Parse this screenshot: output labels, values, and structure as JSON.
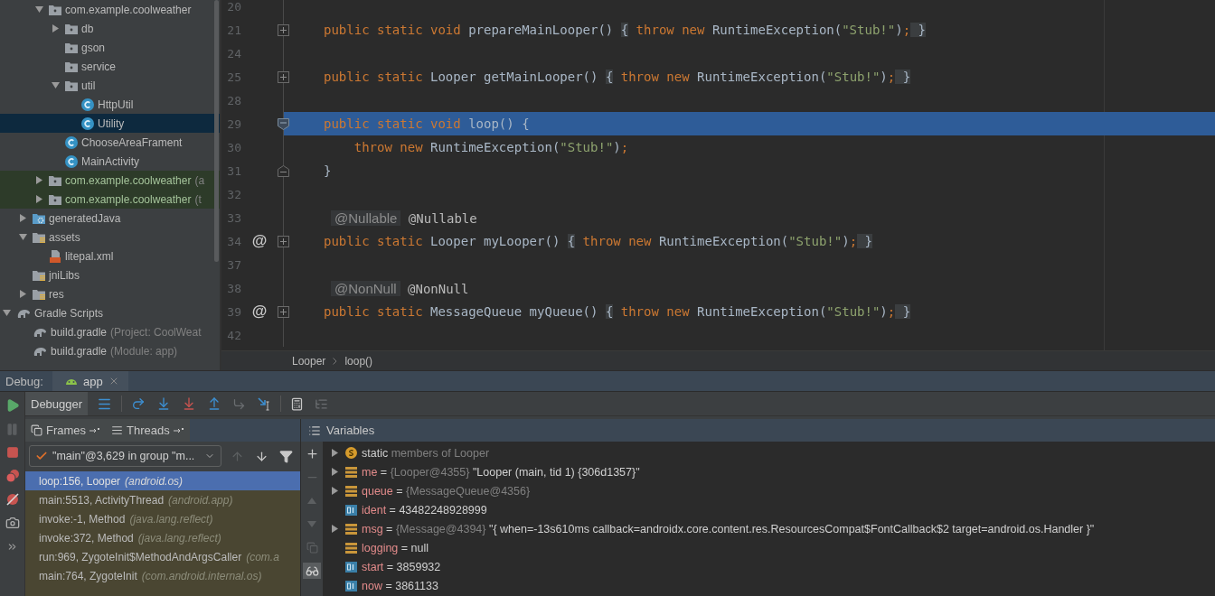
{
  "project_tree": [
    {
      "children": [
        {
          "children": [
            {
              "label": "com.example.coolweather",
              "kind": "package",
              "expanded": true,
              "selected": false,
              "children": [
                {
                  "label": "db",
                  "kind": "package",
                  "expanded": false,
                  "selected": false
                },
                {
                  "label": "gson",
                  "kind": "package",
                  "selected": false
                },
                {
                  "label": "service",
                  "kind": "package",
                  "selected": false
                },
                {
                  "label": "util",
                  "kind": "package",
                  "expanded": true,
                  "selected": false,
                  "children": [
                    {
                      "label": "HttpUtil",
                      "kind": "class",
                      "selected": false
                    },
                    {
                      "label": "Utility",
                      "kind": "class",
                      "selected": true
                    }
                  ]
                },
                {
                  "label": "ChooseAreaFrament",
                  "kind": "class",
                  "selected": false
                },
                {
                  "label": "MainActivity",
                  "kind": "class",
                  "selected": false
                }
              ]
            },
            {
              "label": "com.example.coolweather",
              "suffix": "(a",
              "kind": "test_package",
              "expanded": false,
              "selected": false
            },
            {
              "label": "com.example.coolweather",
              "suffix": "(t",
              "kind": "test_package",
              "expanded": false,
              "selected": false
            }
          ]
        },
        {
          "label": "generatedJava",
          "kind": "generated",
          "expanded": false,
          "selected": false
        },
        {
          "label": "assets",
          "kind": "resources",
          "expanded": true,
          "selected": false,
          "children": [
            {
              "label": "litepal.xml",
              "kind": "xml",
              "selected": false
            }
          ]
        },
        {
          "label": "jniLibs",
          "kind": "resources",
          "selected": false
        },
        {
          "label": "res",
          "kind": "resources",
          "expanded": false,
          "selected": false
        }
      ]
    },
    {
      "label": "Gradle Scripts",
      "kind": "gradle",
      "expanded": true,
      "selected": false,
      "children": [
        {
          "label": "build.gradle",
          "suffix": "(Project: CoolWeat",
          "kind": "gradle",
          "selected": false
        },
        {
          "label": "build.gradle",
          "suffix": "(Module: app)",
          "kind": "gradle",
          "selected": false
        }
      ]
    }
  ],
  "editor": {
    "lines": [
      {
        "number": "20",
        "current": false
      },
      {
        "number": "21",
        "current": false,
        "fold": {
          "kind": "collapsed"
        },
        "tokens": [
          {
            "kind": "kw",
            "text": "public static void "
          },
          {
            "kind": "id",
            "text": "prepareMainLooper() "
          },
          {
            "kind": "folded",
            "text": "{"
          },
          {
            "kind": "kw",
            "text": " throw new "
          },
          {
            "kind": "id",
            "text": "RuntimeException("
          },
          {
            "kind": "str",
            "text": "\"Stub!\""
          },
          {
            "kind": "id",
            "text": ")"
          },
          {
            "kind": "kw",
            "text": ";"
          },
          {
            "kind": "folded",
            "text": " }"
          }
        ]
      },
      {
        "number": "24",
        "current": false
      },
      {
        "number": "25",
        "current": false,
        "fold": {
          "kind": "collapsed"
        },
        "tokens": [
          {
            "kind": "kw",
            "text": "public static "
          },
          {
            "kind": "id",
            "text": "Looper getMainLooper() "
          },
          {
            "kind": "folded",
            "text": "{"
          },
          {
            "kind": "kw",
            "text": " throw new "
          },
          {
            "kind": "id",
            "text": "RuntimeException("
          },
          {
            "kind": "str",
            "text": "\"Stub!\""
          },
          {
            "kind": "id",
            "text": ")"
          },
          {
            "kind": "kw",
            "text": ";"
          },
          {
            "kind": "folded",
            "text": " }"
          }
        ]
      },
      {
        "number": "28",
        "current": false
      },
      {
        "number": "29",
        "current": true,
        "fold": {
          "kind": "open"
        },
        "tokens": [
          {
            "kind": "kw",
            "text": "public static void "
          },
          {
            "kind": "id",
            "text": "loop() {"
          }
        ]
      },
      {
        "number": "30",
        "current": false,
        "tokens": [
          {
            "kind": "kw",
            "text": "    throw new "
          },
          {
            "kind": "id",
            "text": "RuntimeException("
          },
          {
            "kind": "str",
            "text": "\"Stub!\""
          },
          {
            "kind": "id",
            "text": ")"
          },
          {
            "kind": "kw",
            "text": ";"
          }
        ]
      },
      {
        "number": "31",
        "current": false,
        "fold": {
          "kind": "close"
        },
        "tokens": [
          {
            "kind": "id",
            "text": "}"
          }
        ]
      },
      {
        "number": "32",
        "current": false
      },
      {
        "number": "33",
        "current": false,
        "tokens": [
          {
            "kind": "hint",
            "text": "@Nullable"
          },
          {
            "kind": "ann",
            "text": " @Nullable"
          }
        ]
      },
      {
        "number": "34",
        "current": false,
        "gutter": "@",
        "fold": {
          "kind": "collapsed"
        },
        "tokens": [
          {
            "kind": "kw",
            "text": "public static "
          },
          {
            "kind": "id",
            "text": "Looper myLooper() "
          },
          {
            "kind": "folded",
            "text": "{"
          },
          {
            "kind": "kw",
            "text": " throw new "
          },
          {
            "kind": "id",
            "text": "RuntimeException("
          },
          {
            "kind": "str",
            "text": "\"Stub!\""
          },
          {
            "kind": "id",
            "text": ")"
          },
          {
            "kind": "kw",
            "text": ";"
          },
          {
            "kind": "folded",
            "text": " }"
          }
        ]
      },
      {
        "number": "37",
        "current": false
      },
      {
        "number": "38",
        "current": false,
        "tokens": [
          {
            "kind": "hint",
            "text": "@NonNull"
          },
          {
            "kind": "ann",
            "text": " @NonNull"
          }
        ]
      },
      {
        "number": "39",
        "current": false,
        "gutter": "@",
        "fold": {
          "kind": "collapsed"
        },
        "tokens": [
          {
            "kind": "kw",
            "text": "public static "
          },
          {
            "kind": "id",
            "text": "MessageQueue myQueue() "
          },
          {
            "kind": "folded",
            "text": "{"
          },
          {
            "kind": "kw",
            "text": " throw new "
          },
          {
            "kind": "id",
            "text": "RuntimeException("
          },
          {
            "kind": "str",
            "text": "\"Stub!\""
          },
          {
            "kind": "id",
            "text": ")"
          },
          {
            "kind": "kw",
            "text": ";"
          },
          {
            "kind": "folded",
            "text": " }"
          }
        ]
      },
      {
        "number": "42",
        "current": false
      }
    ],
    "breadcrumb": [
      "Looper",
      "loop()"
    ]
  },
  "debug": {
    "title": "Debug:",
    "run_tab": "app",
    "toolbar_tab": "Debugger",
    "frames_header": "Frames",
    "threads_header": "Threads",
    "variables_header": "Variables",
    "thread_selector": "\"main\"@3,629 in group \"m...",
    "frames": [
      {
        "method": "loop:156, Looper",
        "package": "(android.os)",
        "selected": true
      },
      {
        "method": "main:5513, ActivityThread",
        "package": "(android.app)",
        "selected": false
      },
      {
        "method": "invoke:-1, Method",
        "package": "(java.lang.reflect)",
        "selected": false
      },
      {
        "method": "invoke:372, Method",
        "package": "(java.lang.reflect)",
        "selected": false
      },
      {
        "method": "run:969, ZygoteInit$MethodAndArgsCaller",
        "package": "(com.a",
        "selected": false
      },
      {
        "method": "main:764, ZygoteInit",
        "package": "(com.android.internal.os)",
        "selected": false
      }
    ],
    "variables": [
      {
        "kind": "static",
        "expanded": false,
        "name": "static",
        "type": "members of Looper"
      },
      {
        "kind": "field",
        "expanded": false,
        "name": "me",
        "operator": "=",
        "type": "{Looper@4355}",
        "value": "\"Looper (main, tid 1) {306d1357}\""
      },
      {
        "kind": "field",
        "expanded": false,
        "name": "queue",
        "operator": "=",
        "type": "{MessageQueue@4356}"
      },
      {
        "kind": "primitive",
        "name": "ident",
        "operator": "=",
        "value": "43482248928999"
      },
      {
        "kind": "field",
        "expanded": false,
        "name": "msg",
        "operator": "=",
        "type": "{Message@4394}",
        "value": "\"{ when=-13s610ms callback=androidx.core.content.res.ResourcesCompat$FontCallback$2 target=android.os.Handler }\""
      },
      {
        "kind": "field",
        "name": "logging",
        "operator": "=",
        "value": "null"
      },
      {
        "kind": "primitive",
        "name": "start",
        "operator": "=",
        "value": "3859932"
      },
      {
        "kind": "primitive",
        "name": "now",
        "operator": "=",
        "value": "3861133"
      }
    ]
  }
}
